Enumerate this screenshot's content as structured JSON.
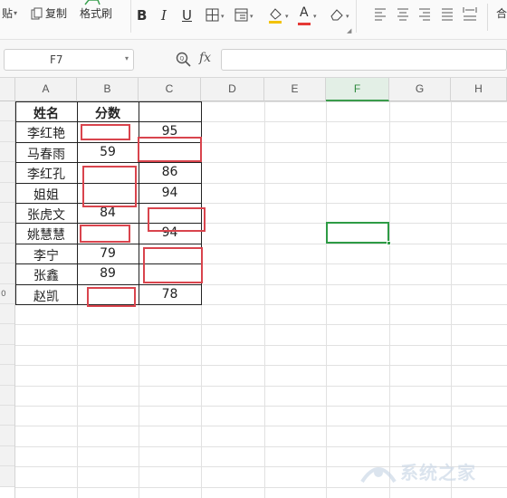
{
  "toolbar": {
    "paste_label": "贴",
    "copy_label": "复制",
    "format_painter_label": "格式刷",
    "bold_label": "B",
    "italic_label": "I",
    "underline_label": "U",
    "font_color_letter": "A",
    "font_color": "#e53935",
    "fill_color": "#f2c200",
    "right_clip": "合"
  },
  "formula_bar": {
    "name_box_value": "F7",
    "fx_label": "fx",
    "formula_value": ""
  },
  "columns": [
    "A",
    "B",
    "C",
    "D",
    "E",
    "F",
    "G",
    "H"
  ],
  "selected_column": "F",
  "row_numbers": [
    "",
    "",
    "",
    "",
    "",
    "",
    "",
    "",
    "",
    "0",
    "",
    "",
    "",
    "",
    "",
    "",
    "",
    "",
    "",
    ""
  ],
  "table": {
    "header": {
      "name": "姓名",
      "score": "分数"
    },
    "rows": [
      {
        "name": "李红艳",
        "b": "",
        "c": "95"
      },
      {
        "name": "马春雨",
        "b": "59",
        "c": ""
      },
      {
        "name": "李红孔",
        "b": "",
        "c": "86"
      },
      {
        "name": "姐姐",
        "b": "",
        "c": "94"
      },
      {
        "name": "张虎文",
        "b": "84",
        "c": ""
      },
      {
        "name": "姚慧慧",
        "b": "",
        "c": "94"
      },
      {
        "name": "李宁",
        "b": "79",
        "c": ""
      },
      {
        "name": "张鑫",
        "b": "89",
        "c": ""
      },
      {
        "name": "赵凯",
        "b": "",
        "c": "78"
      }
    ]
  },
  "colors": {
    "highlight_box": "#d9444d",
    "active_cell": "#2e9b45"
  },
  "watermark": "系统之家"
}
